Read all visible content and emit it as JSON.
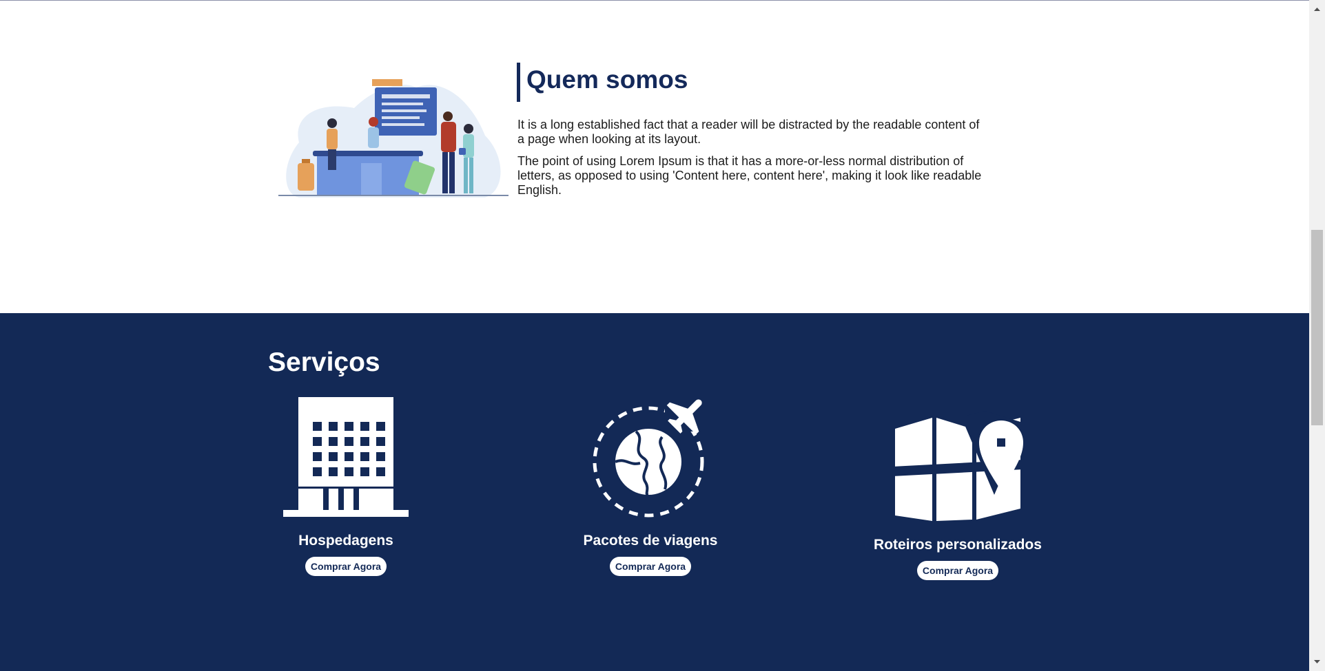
{
  "about": {
    "title": "Quem somos",
    "paragraphs": [
      "It is a long established fact that a reader will be distracted by the readable content of a page when looking at its layout.",
      "The point of using Lorem Ipsum is that it has a more-or-less normal distribution of letters, as opposed to using 'Content here, content here', making it look like readable English."
    ]
  },
  "services": {
    "title": "Serviços",
    "items": [
      {
        "name": "Hospedagens",
        "button": "Comprar Agora",
        "icon": "building-icon"
      },
      {
        "name": "Pacotes de viagens",
        "button": "Comprar Agora",
        "icon": "globe-plane-icon"
      },
      {
        "name": "Roteiros personalizados",
        "button": "Comprar Agora",
        "icon": "map-pin-icon"
      }
    ]
  },
  "colors": {
    "navy": "#132956",
    "title": "#14295a",
    "text": "#1b1b1b",
    "white": "#ffffff"
  }
}
